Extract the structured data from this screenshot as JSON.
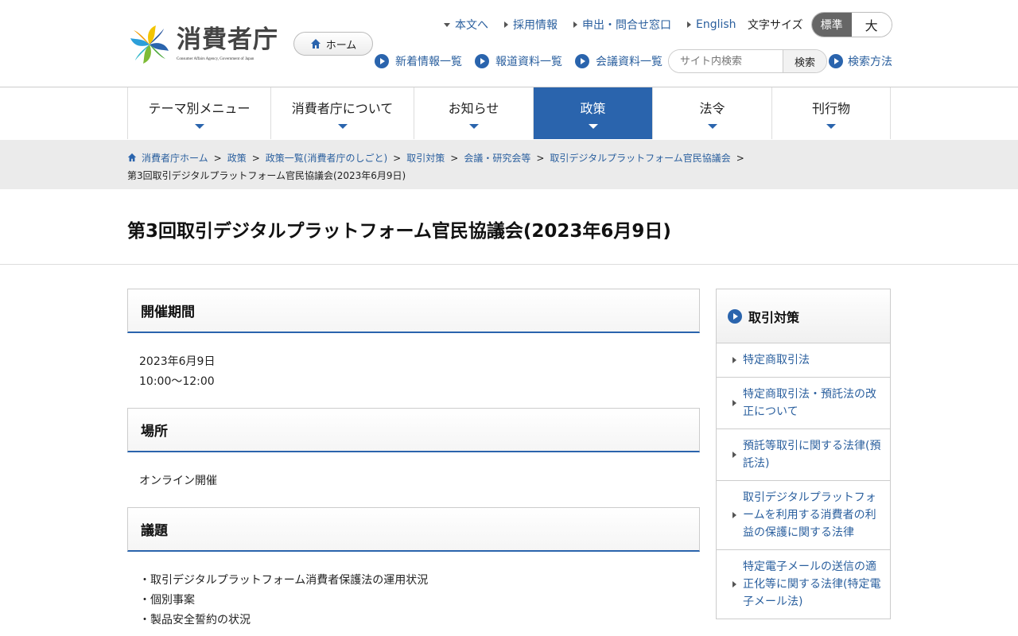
{
  "header": {
    "logo_text": "消費者庁",
    "logo_sub": "Consumer Affairs Agency, Government of Japan",
    "home_label": "ホーム",
    "util_links": [
      {
        "label": "本文へ",
        "marker": "down"
      },
      {
        "label": "採用情報",
        "marker": "right"
      },
      {
        "label": "申出・問合せ窓口",
        "marker": "right"
      },
      {
        "label": "English",
        "marker": "right"
      }
    ],
    "font_size_label": "文字サイズ",
    "font_size_normal": "標準",
    "font_size_large": "大",
    "sub_links": [
      "新着情報一覧",
      "報道資料一覧",
      "会議資料一覧"
    ],
    "search_placeholder": "サイト内検索",
    "search_button": "検索",
    "search_help": "検索方法"
  },
  "gnav": {
    "items": [
      {
        "label": "テーマ別メニュー",
        "active": false
      },
      {
        "label": "消費者庁について",
        "active": false
      },
      {
        "label": "お知らせ",
        "active": false
      },
      {
        "label": "政策",
        "active": true
      },
      {
        "label": "法令",
        "active": false
      },
      {
        "label": "刊行物",
        "active": false
      }
    ]
  },
  "breadcrumb": {
    "items": [
      "消費者庁ホーム",
      "政策",
      "政策一覧(消費者庁のしごと)",
      "取引対策",
      "会議・研究会等",
      "取引デジタルプラットフォーム官民協議会"
    ],
    "current": "第3回取引デジタルプラットフォーム官民協議会(2023年6月9日)"
  },
  "page_title": "第3回取引デジタルプラットフォーム官民協議会(2023年6月9日)",
  "main": {
    "date_heading": "開催期間",
    "date_lines": [
      "2023年6月9日",
      "10:00～12:00"
    ],
    "place_heading": "場所",
    "place_text": "オンライン開催",
    "agenda_heading": "議題",
    "agenda_items": [
      "・取引デジタルプラットフォーム消費者保護法の運用状況",
      "・個別事案",
      "・製品安全誓約の状況"
    ]
  },
  "sidebar": {
    "heading": "取引対策",
    "items": [
      "特定商取引法",
      "特定商取引法・預託法の改正について",
      "預託等取引に関する法律(預託法)",
      "取引デジタルプラットフォームを利用する消費者の利益の保護に関する法律",
      "特定電子メールの送信の適正化等に関する法律(特定電子メール法)"
    ]
  },
  "colors": {
    "accent": "#2a64ad",
    "link": "#2a5f9e",
    "breadcrumb_bg": "#ebebeb"
  }
}
